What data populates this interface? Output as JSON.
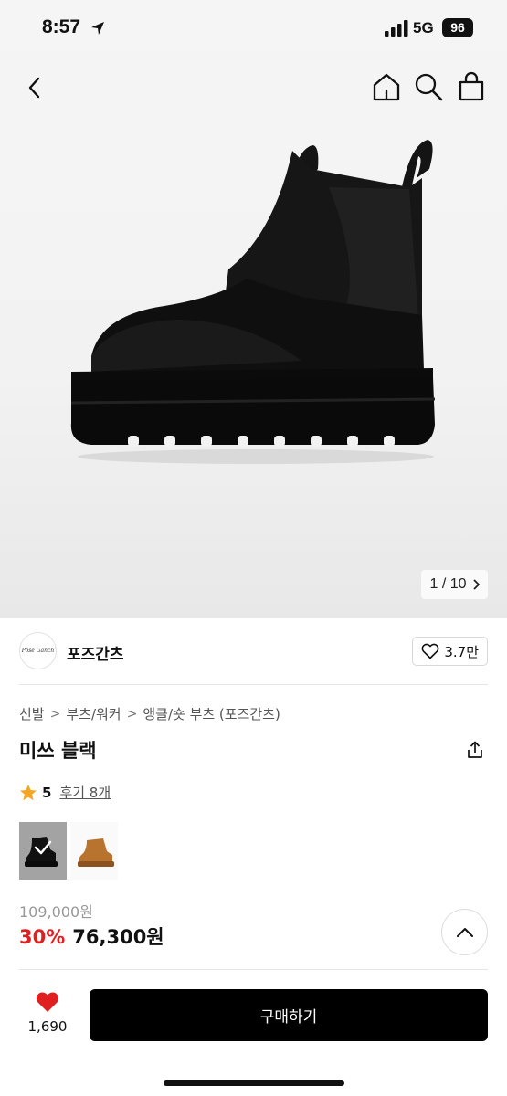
{
  "status_bar": {
    "time": "8:57",
    "network": "5G",
    "battery": "96"
  },
  "nav": {
    "icons": [
      "chevron-left-icon",
      "home-icon",
      "search-icon",
      "shopping-bag-icon"
    ]
  },
  "gallery": {
    "counter": "1 / 10"
  },
  "brand": {
    "logo_text": "Pose Ganch",
    "name": "포즈간츠",
    "likes": "3.7만"
  },
  "breadcrumb": [
    "신발",
    "부츠/워커",
    "앵클/숏 부츠 (포즈간츠)"
  ],
  "product": {
    "title": "미쓰 블랙",
    "rating": "5",
    "review_link": "후기 8개",
    "variants": [
      {
        "color": "black",
        "selected": true
      },
      {
        "color": "tan",
        "selected": false
      }
    ],
    "original_price": "109,000원",
    "discount": "30%",
    "price": "76,300원"
  },
  "bottom_bar": {
    "wish_count": "1,690",
    "buy_label": "구매하기"
  },
  "colors": {
    "accent_red": "#e02020",
    "star": "#f5a623",
    "button_bg": "#000000"
  }
}
